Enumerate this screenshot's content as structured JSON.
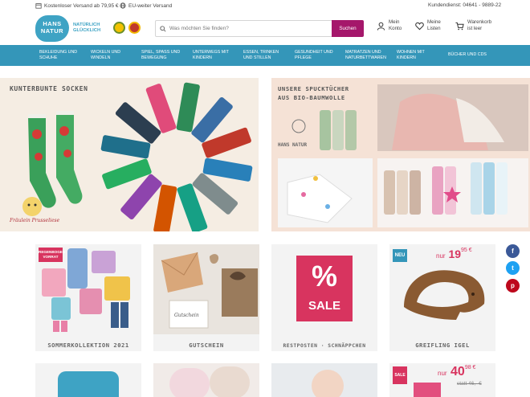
{
  "topbar": {
    "shipping": "Kostenloser Versand ab 79,95 €",
    "eu_shipping": "EU-weiter Versand",
    "service": "Kundendienst: 04641 - 9889-22"
  },
  "header": {
    "logo_text_1": "HANS",
    "logo_text_2": "NATUR",
    "tagline_1": "NATÜRLICH",
    "tagline_2": "GLÜCKLICH",
    "search_placeholder": "Was möchten Sie finden?",
    "search_button": "Suchen",
    "account_1": "Mein",
    "account_2": "Konto",
    "wishlist_1": "Meine",
    "wishlist_2": "Listen",
    "cart_1": "Warenkorb",
    "cart_2": "ist leer"
  },
  "nav": [
    {
      "l1": "Bekleidung und",
      "l2": "Schuhe"
    },
    {
      "l1": "Wickeln und",
      "l2": "Windeln"
    },
    {
      "l1": "Spiel, Spaß und",
      "l2": "Bewegung"
    },
    {
      "l1": "Unterwegs mit",
      "l2": "Kindern"
    },
    {
      "l1": "Essen, Trinken",
      "l2": "und Stillen"
    },
    {
      "l1": "Gesundheit und",
      "l2": "Pflege"
    },
    {
      "l1": "Matratzen und",
      "l2": "Naturbettwaren"
    },
    {
      "l1": "Wohnen mit",
      "l2": "Kindern"
    },
    {
      "l1": "Bücher und CDs",
      "l2": ""
    }
  ],
  "banners": {
    "left_title": "KUNTERBUNTE SOCKEN",
    "left_brand": "Fräulein Prusseliese",
    "right_title_1": "UNSERE SPUCKTÜCHER",
    "right_title_2": "AUS BIO-BAUMWOLLE",
    "right_brand": "HANS NATUR"
  },
  "tiles": [
    {
      "caption": "SOMMERKOLLEKTION 2021",
      "badge": "REGENBOGEN VORRAT"
    },
    {
      "caption": "GUTSCHEIN",
      "card_text": "Gutschein"
    },
    {
      "caption": "RESTPOSTEN · SCHNÄPPCHEN",
      "sale": "SALE"
    },
    {
      "caption": "GREIFLING IGEL",
      "badge": "NEU",
      "price_prefix": "nur",
      "price": "19",
      "price_cents": "95 €"
    }
  ],
  "tiles_row2": {
    "sale_badge": "SALE",
    "price_prefix": "nur",
    "price": "40",
    "price_cents": "98 €",
    "old_price": "statt 46,- €"
  },
  "social": [
    "f",
    "t",
    "p"
  ],
  "colors": {
    "brand_blue": "#3496b9",
    "accent_magenta": "#a5176b",
    "sale_red": "#d8345f"
  }
}
